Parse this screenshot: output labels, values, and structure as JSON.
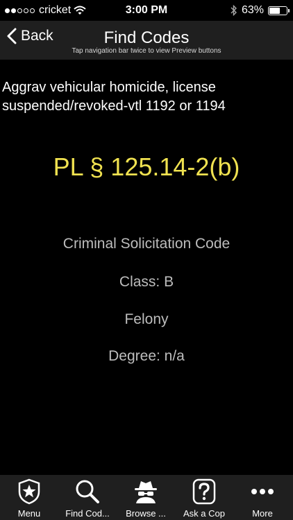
{
  "status_bar": {
    "carrier": "cricket",
    "time": "3:00 PM",
    "battery": "63%",
    "battery_level": 0.63,
    "signal_bars_filled": 2,
    "signal_bars_total": 5
  },
  "nav": {
    "back_label": "Back",
    "title": "Find Codes",
    "hint": "Tap navigation bar twice to view Preview buttons"
  },
  "content": {
    "description": "Aggrav vehicular homicide, license suspended/revoked-vtl 1192 or 1194",
    "code": "PL § 125.14-2(b)",
    "criminal_solicitation": "Criminal Solicitation Code",
    "class": "Class: B",
    "type": "Felony",
    "degree": "Degree: n/a"
  },
  "tab_bar": {
    "items": [
      {
        "label": "Menu",
        "icon": "badge-star-icon"
      },
      {
        "label": "Find Cod...",
        "icon": "search-icon"
      },
      {
        "label": "Browse ...",
        "icon": "spy-icon"
      },
      {
        "label": "Ask a Cop",
        "icon": "question-icon"
      },
      {
        "label": "More",
        "icon": "more-icon"
      }
    ]
  },
  "colors": {
    "code_accent": "#f0e250",
    "bar_background": "#1f1f1f",
    "info_text": "#bdbdbd"
  }
}
